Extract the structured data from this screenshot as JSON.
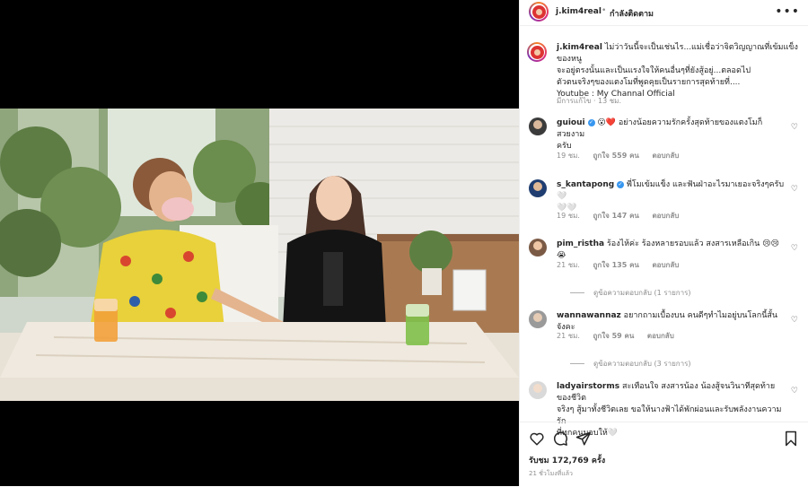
{
  "post": {
    "username": "j.kim4real",
    "separator": "•",
    "follow_status": "กำลังติดตาม",
    "more_icon": "more-horizontal-icon"
  },
  "caption": {
    "username": "j.kim4real",
    "text_line1": "ไม่ว่าวันนี้จะเป็นเช่นไร...แม่เชื่อว่าจิตวิญญาณที่เข้มแข็งของหนู",
    "text_line2": "จะอยู่ตรงนั้นและเป็นแรงใจให้คนอื่นๆที่ยังสู้อยู่...ตลอดไป",
    "text_line3": "ตัวตนจริงๆของแตงโมที่พูดคุยเป็นรายการสุดท้ายที่....",
    "text_line4": "Youtube : My Channal Official",
    "meta": "มีการแก้ไข · 13 ชม."
  },
  "comments": [
    {
      "username": "guioui",
      "verified": true,
      "text_line1": "😮❤️ อย่างน้อยความรักครั้งสุดท้ายของแตงโมก็สวยงาม",
      "text_line2": "ครับ",
      "time": "19 ชม.",
      "likes": "ถูกใจ 559 คน",
      "reply": "ตอบกลับ",
      "replies_label": ""
    },
    {
      "username": "s_kantapong",
      "verified": true,
      "text_line1": "พี่โมเข้มแข็ง และฟันฝ่าอะไรมาเยอะจริงๆครับ🤍",
      "text_line2": "🤍🤍",
      "time": "19 ชม.",
      "likes": "ถูกใจ 147 คน",
      "reply": "ตอบกลับ",
      "replies_label": ""
    },
    {
      "username": "pim_ristha",
      "verified": false,
      "text_line1": "ร้องไห้ค่ะ ร้องหลายรอบแล้ว สงสารเหลือเกิน 😢😢😭",
      "text_line2": "",
      "time": "21 ชม.",
      "likes": "ถูกใจ 135 คน",
      "reply": "ตอบกลับ",
      "replies_label": "ดูข้อความตอบกลับ (1 รายการ)"
    },
    {
      "username": "wannawannaz",
      "verified": false,
      "text_line1": "อยากถามเบื้องบน คนดีๆทำไมอยู่บนโลกนี้สั้นจังคะ",
      "text_line2": "",
      "time": "21 ชม.",
      "likes": "ถูกใจ 59 คน",
      "reply": "ตอบกลับ",
      "replies_label": "ดูข้อความตอบกลับ (3 รายการ)"
    },
    {
      "username": "ladyairstorms",
      "verified": false,
      "text_line1": "สะเทือนใจ สงสารน้อง น้องสู้จนวินาทีสุดท้ายของชีวิต",
      "text_line2": "จริงๆ สู้มาทั้งชีวิตเลย ขอให้นางฟ้าได้พักผ่อนและรับพลังงานความรัก",
      "text_line3": "ที่ทุกคนมอบให้🤍",
      "time": "",
      "likes": "",
      "reply": "",
      "replies_label": ""
    }
  ],
  "actions": {
    "like_icon": "heart-icon",
    "comment_icon": "comment-icon",
    "share_icon": "send-icon",
    "save_icon": "bookmark-icon",
    "views": "รับชม 172,769 ครั้ง",
    "posted": "21 ชั่วโมงที่แล้ว"
  }
}
